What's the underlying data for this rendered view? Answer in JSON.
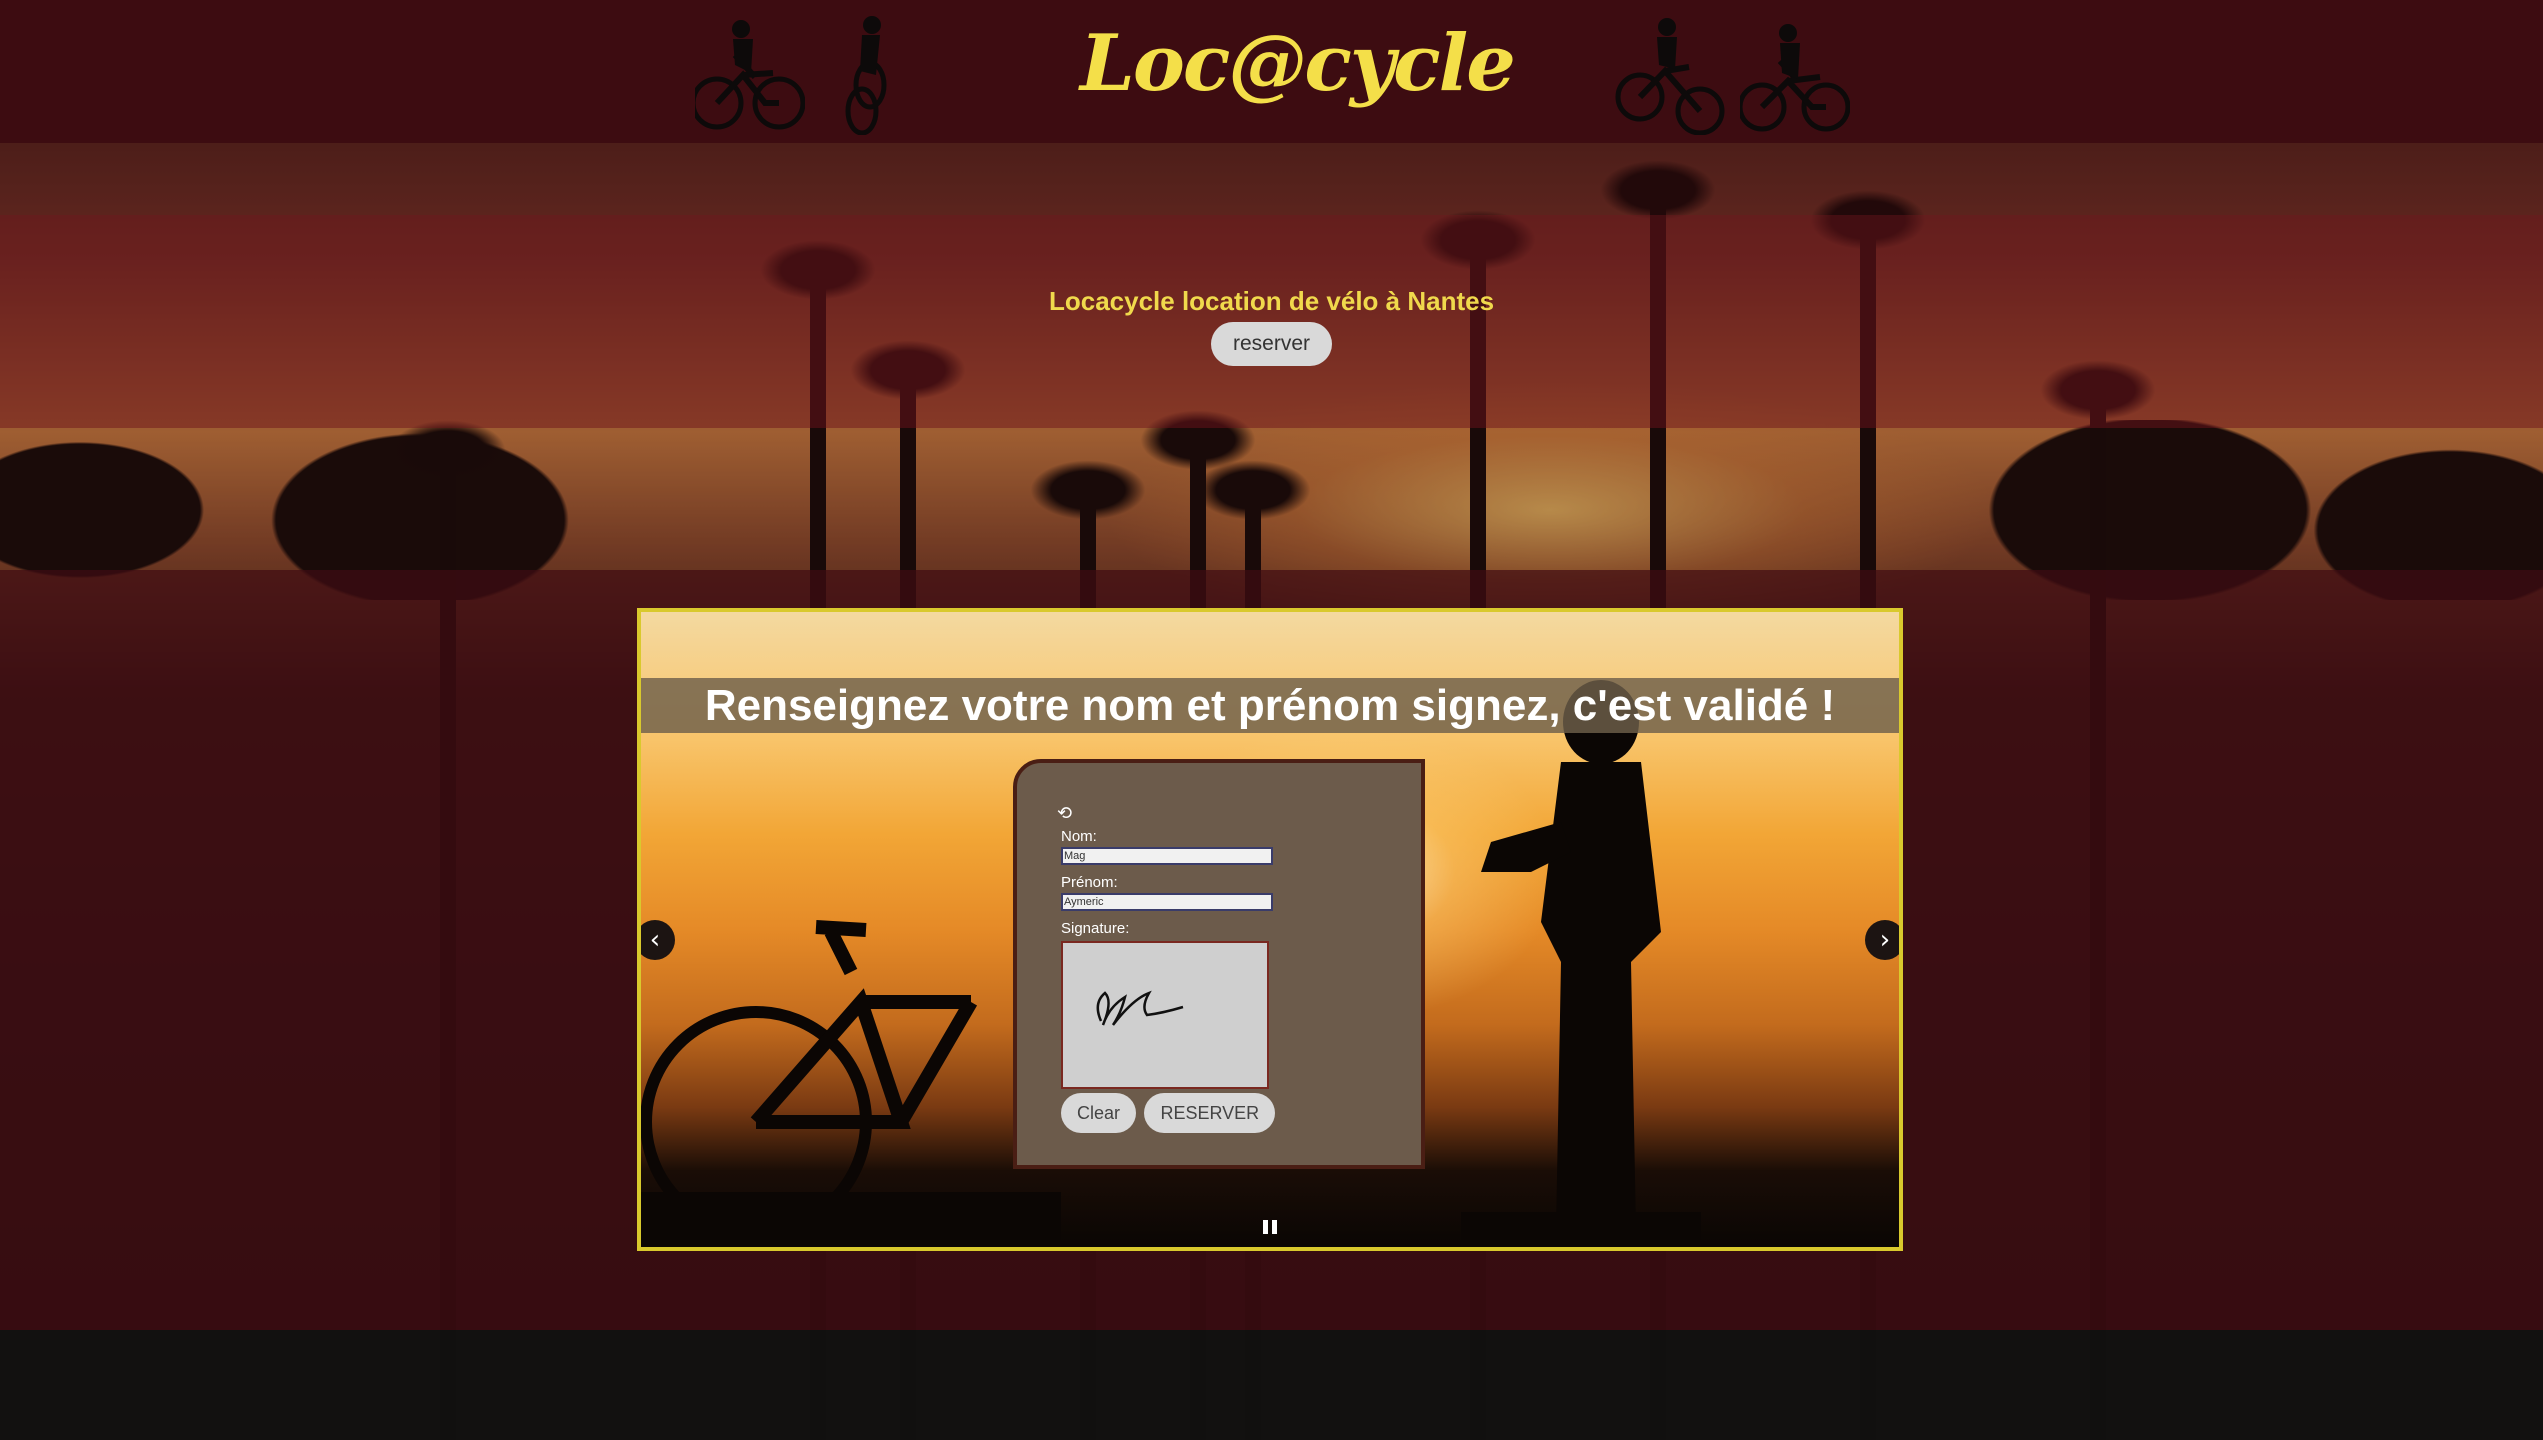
{
  "header": {
    "logo_text": "Loc@cycle"
  },
  "hero": {
    "title": "Locacycle location de vélo à Nantes",
    "reserve_button": "reserver"
  },
  "slider": {
    "caption": "Renseignez votre nom et prénom signez, c'est validé !",
    "prev_icon": "chevron-left-icon",
    "next_icon": "chevron-right-icon",
    "pause_icon": "pause-icon"
  },
  "form": {
    "reload_icon": "reload-icon",
    "nom_label": "Nom:",
    "nom_value": "Mag",
    "prenom_label": "Prénom:",
    "prenom_value": "Aymeric",
    "signature_label": "Signature:",
    "clear_button": "Clear",
    "reserve_button": "RESERVER"
  },
  "colors": {
    "header_bg": "#3d0c11",
    "logo_yellow": "#f4df49",
    "slider_border": "#d9c92d",
    "form_bg": "#6c5b4b"
  }
}
